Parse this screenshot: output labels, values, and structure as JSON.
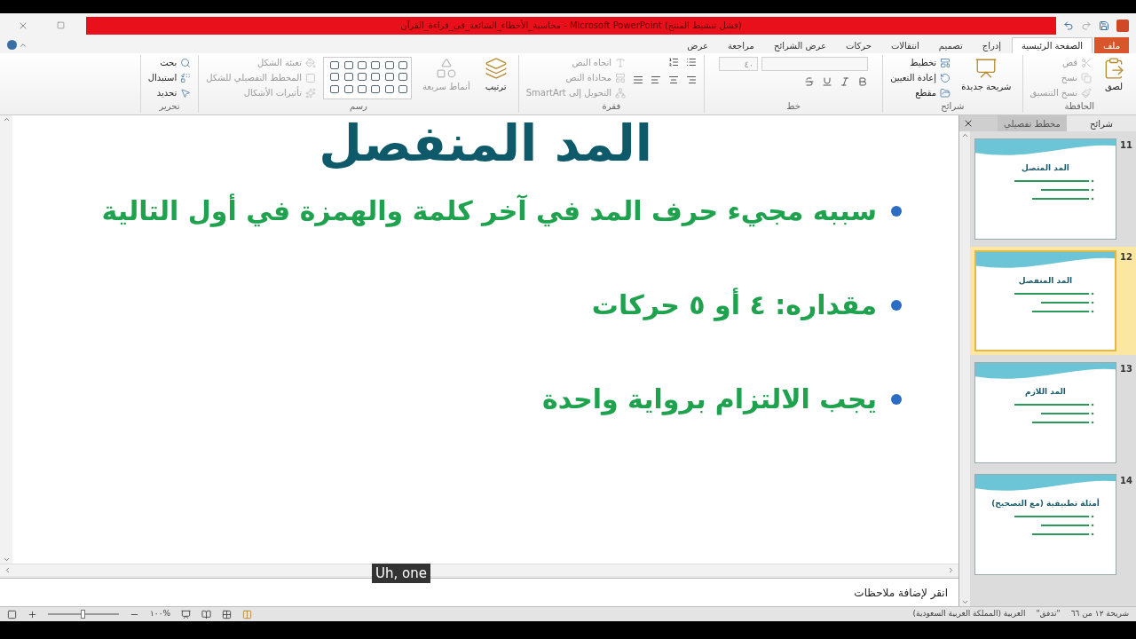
{
  "title_bar": {
    "title": "محاسبة_الأخطاء_الشائعة_في_قراءة_القرآن - Microsoft PowerPoint (فشل تنشيط المنتج)"
  },
  "ribbon_tabs": [
    {
      "label": "ملف",
      "kind": "file",
      "selected": false
    },
    {
      "label": "الصفحة الرئيسية",
      "kind": "tab",
      "selected": true
    },
    {
      "label": "إدراج",
      "kind": "tab",
      "selected": false
    },
    {
      "label": "تصميم",
      "kind": "tab",
      "selected": false
    },
    {
      "label": "انتقالات",
      "kind": "tab",
      "selected": false
    },
    {
      "label": "حركات",
      "kind": "tab",
      "selected": false
    },
    {
      "label": "عرض الشرائح",
      "kind": "tab",
      "selected": false
    },
    {
      "label": "مراجعة",
      "kind": "tab",
      "selected": false
    },
    {
      "label": "عرض",
      "kind": "tab",
      "selected": false
    }
  ],
  "ribbon_groups": [
    {
      "name": "الحافظة",
      "kind": "clipboard",
      "items": [
        {
          "label": "لصق",
          "kind": "large",
          "disabled": false
        },
        {
          "label": "قص",
          "kind": "small",
          "disabled": true
        },
        {
          "label": "نسخ",
          "kind": "small",
          "disabled": true
        },
        {
          "label": "نسخ التنسيق",
          "kind": "small",
          "disabled": true
        }
      ]
    },
    {
      "name": "شرائح",
      "kind": "slides",
      "items": [
        {
          "label": "شريحة جديدة",
          "kind": "large",
          "disabled": false
        },
        {
          "label": "تخطيط",
          "kind": "small",
          "disabled": false
        },
        {
          "label": "إعادة التعيين",
          "kind": "small",
          "disabled": false
        },
        {
          "label": "مقطع",
          "kind": "small",
          "disabled": false
        }
      ]
    },
    {
      "name": "خط",
      "kind": "font",
      "font_size": "٤٠"
    },
    {
      "name": "فقرة",
      "kind": "paragraph",
      "items": [
        {
          "label": "اتجاه النص",
          "kind": "small",
          "disabled": true
        },
        {
          "label": "محاذاة النص",
          "kind": "small",
          "disabled": true
        },
        {
          "label": "التحويل إلى SmartArt",
          "kind": "small",
          "disabled": true
        }
      ]
    },
    {
      "name": "رسم",
      "kind": "drawing",
      "items": [
        {
          "label": "ترتيب",
          "kind": "large",
          "disabled": false
        },
        {
          "label": "أنماط سريعة",
          "kind": "large",
          "disabled": true
        },
        {
          "label": "تعبئة الشكل",
          "kind": "small",
          "disabled": true
        },
        {
          "label": "المخطط التفصيلي للشكل",
          "kind": "small",
          "disabled": true
        },
        {
          "label": "تأثيرات الأشكال",
          "kind": "small",
          "disabled": true
        }
      ]
    },
    {
      "name": "تحرير",
      "kind": "editing",
      "items": [
        {
          "label": "بحث",
          "kind": "small",
          "disabled": false
        },
        {
          "label": "استبدال",
          "kind": "small",
          "disabled": false
        },
        {
          "label": "تحديد",
          "kind": "small",
          "disabled": false
        }
      ]
    }
  ],
  "slides_pane": {
    "tabs": [
      {
        "label": "شرائح",
        "selected": true
      },
      {
        "label": "مخطط تفصيلي",
        "selected": false
      }
    ],
    "thumbnails": [
      {
        "number": "11",
        "title": "المد المتصل",
        "selected": false
      },
      {
        "number": "12",
        "title": "المد المنفصل",
        "selected": true
      },
      {
        "number": "13",
        "title": "المد اللازم",
        "selected": false
      },
      {
        "number": "14",
        "title": "أمثلة تطبيقية (مع التصحيح)",
        "selected": false
      }
    ]
  },
  "slide": {
    "title": "المد المنفصل",
    "bullets": [
      "سببه مجيء حرف المد في آخر كلمة والهمزة في أول التالية",
      "مقداره: ٤ أو ٥ حركات",
      "يجب الالتزام برواية واحدة"
    ]
  },
  "caption": "Uh, one",
  "notes": {
    "placeholder": "انقر لإضافة ملاحظات"
  },
  "status_bar": {
    "slide": "شريحة ١٢ من ٦٦",
    "theme": "\"تدفق\"",
    "language": "العربية (المملكة العربية السعودية)",
    "zoom": "%١٠٠",
    "zoom_level": {
      "level": 0.5
    }
  }
}
